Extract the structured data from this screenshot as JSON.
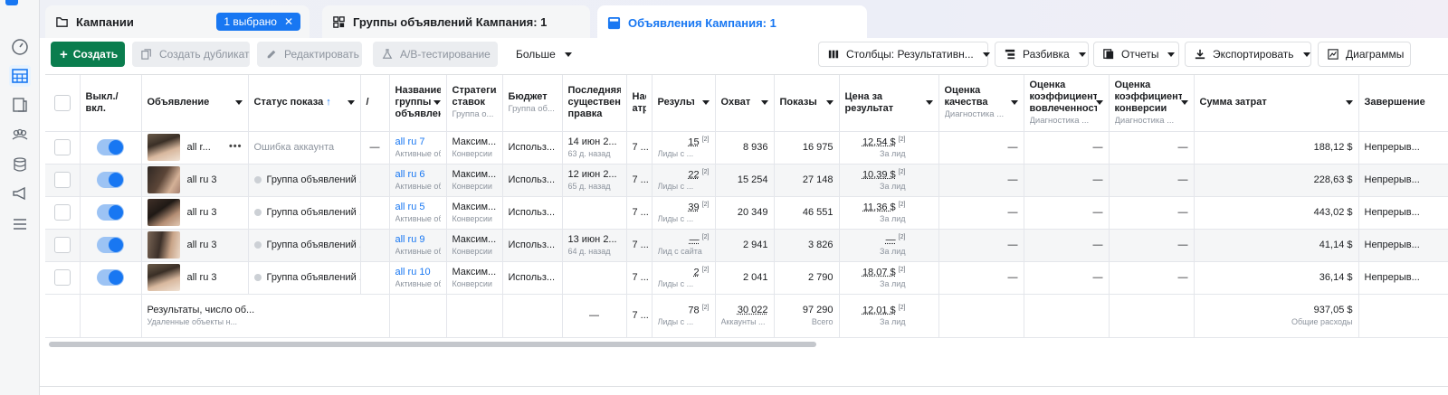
{
  "tabs": [
    {
      "label": "Кампании",
      "badge": "1 выбрано",
      "badge_close": "✕"
    },
    {
      "label": "Группы объявлений Кампания: 1"
    },
    {
      "label": "Объявления Кампания: 1"
    }
  ],
  "toolbar": {
    "create": "Создать",
    "duplicate": "Создать дубликат",
    "edit": "Редактировать",
    "ab_test": "A/B-тестирование",
    "more": "Больше",
    "columns": "Столбцы: Результативн...",
    "breakdown": "Разбивка",
    "reports": "Отчеты",
    "export": "Экспортировать",
    "charts": "Диаграммы"
  },
  "headers": {
    "toggle": "Выкл./ вкл.",
    "ad": "Объявление",
    "status": "Статус показа",
    "status_arrow": "↑",
    "narrow": "/",
    "adset": "Название группы объявлений",
    "adset_sub": "",
    "bid": "Стратегия ставок",
    "bid_sub": "Группа о...",
    "budget": "Бюджет",
    "budget_sub": "Группа об...",
    "last_edit": "Последняя существенная правка",
    "attr": "Настройка атрибуции",
    "results": "Результаты",
    "reach": "Охват",
    "impressions": "Показы",
    "cpr": "Цена за результат",
    "quality": "Оценка качества",
    "quality_sub": "Диагностика ...",
    "engagement": "Оценка коэффициента вовлеченности",
    "engagement_sub": "Диагностика ...",
    "conversion": "Оценка коэффициента конверсии",
    "conversion_sub": "Диагностика ...",
    "spend": "Сумма затрат",
    "end": "Завершение"
  },
  "rows": [
    {
      "ad": "all r...",
      "status": "Ошибка аккаунта",
      "status_dot": false,
      "narrow": "—",
      "adset": "all ru 7",
      "adset_sub": "Активные объ...",
      "bid": "Максим...",
      "bid_sub": "Конверсии",
      "budget": "Использ...",
      "last_edit": "14 июн 2...",
      "last_edit_sub": "63 д. назад",
      "attr": "7 ...",
      "results": "15",
      "results_sub": "Лиды с ...",
      "reach": "8 936",
      "impressions": "16 975",
      "cpr": "12,54 $",
      "cpr_sub": "За лид",
      "quality": "—",
      "engagement": "—",
      "conversion": "—",
      "spend": "188,12 $",
      "end": "Непрерыв..."
    },
    {
      "ad": "all ru 3",
      "status": "Группа объявлений ...",
      "status_dot": true,
      "narrow": "",
      "adset": "all ru 6",
      "adset_sub": "Активные объ...",
      "bid": "Максим...",
      "bid_sub": "Конверсии",
      "budget": "Использ...",
      "last_edit": "12 июн 2...",
      "last_edit_sub": "65 д. назад",
      "attr": "7 ...",
      "results": "22",
      "results_sub": "Лиды с ...",
      "reach": "15 254",
      "impressions": "27 148",
      "cpr": "10,39 $",
      "cpr_sub": "За лид",
      "quality": "—",
      "engagement": "—",
      "conversion": "—",
      "spend": "228,63 $",
      "end": "Непрерыв..."
    },
    {
      "ad": "all ru 3",
      "status": "Группа объявлений ...",
      "status_dot": true,
      "narrow": "",
      "adset": "all ru 5",
      "adset_sub": "Активные объ...",
      "bid": "Максим...",
      "bid_sub": "Конверсии",
      "budget": "Использ...",
      "last_edit": "",
      "last_edit_sub": "",
      "attr": "7 ...",
      "results": "39",
      "results_sub": "Лиды с ...",
      "reach": "20 349",
      "impressions": "46 551",
      "cpr": "11,36 $",
      "cpr_sub": "За лид",
      "quality": "—",
      "engagement": "—",
      "conversion": "—",
      "spend": "443,02 $",
      "end": "Непрерыв..."
    },
    {
      "ad": "all ru 3",
      "status": "Группа объявлений ...",
      "status_dot": true,
      "narrow": "",
      "adset": "all ru 9",
      "adset_sub": "Активные объ...",
      "bid": "Максим...",
      "bid_sub": "Конверсии",
      "budget": "Использ...",
      "last_edit": "13 июн 2...",
      "last_edit_sub": "64 д. назад",
      "attr": "7 ...",
      "results": "—",
      "results_sub": "Лид с сайта",
      "reach": "2 941",
      "impressions": "3 826",
      "cpr": "—",
      "cpr_sub": "За лид",
      "quality": "—",
      "engagement": "—",
      "conversion": "—",
      "spend": "41,14 $",
      "end": "Непрерыв..."
    },
    {
      "ad": "all ru 3",
      "status": "Группа объявлений ...",
      "status_dot": true,
      "narrow": "",
      "adset": "all ru 10",
      "adset_sub": "Активные объ...",
      "bid": "Максим...",
      "bid_sub": "Конверсии",
      "budget": "Использ...",
      "last_edit": "",
      "last_edit_sub": "",
      "attr": "7 ...",
      "results": "2",
      "results_sub": "Лиды с ...",
      "reach": "2 041",
      "impressions": "2 790",
      "cpr": "18,07 $",
      "cpr_sub": "За лид",
      "quality": "—",
      "engagement": "—",
      "conversion": "—",
      "spend": "36,14 $",
      "end": "Непрерыв..."
    }
  ],
  "totals": {
    "label": "Результаты, число об...",
    "label_sub": "Удаленные объекты н...",
    "last_edit": "—",
    "attr": "7 ...",
    "results": "78",
    "results_sub": "Лиды с ...",
    "reach": "30 022",
    "reach_sub": "Аккаунты ...",
    "impressions": "97 290",
    "impressions_sub": "Всего",
    "cpr": "12,01 $",
    "cpr_sub": "За лид",
    "spend": "937,05 $",
    "spend_sub": "Общие расходы"
  },
  "sup_mark": "[2]",
  "more_dots": "•••",
  "colors": {
    "accent": "#1877f2",
    "create": "#0a7d4e"
  }
}
